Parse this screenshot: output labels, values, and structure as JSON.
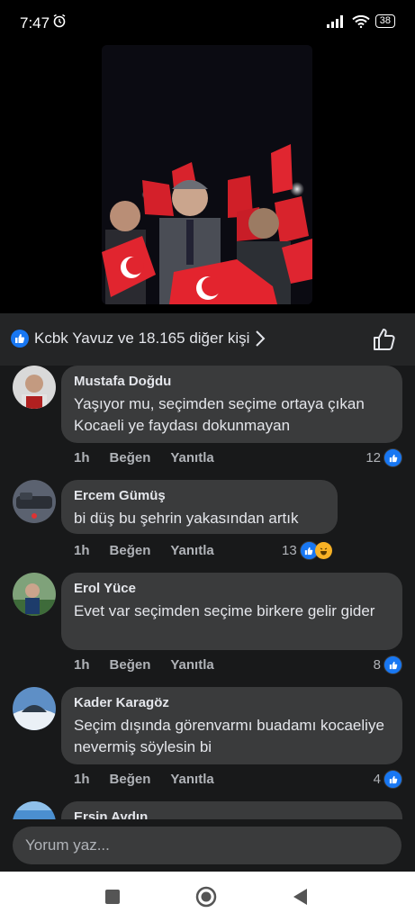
{
  "status": {
    "time": "7:47",
    "battery": "38"
  },
  "reactions": {
    "summary": "Kcbk Yavuz ve 18.165 diğer kişi"
  },
  "comments": [
    {
      "author": "Mustafa Doğdu",
      "text": "Yaşıyor mu, seçimden seçime ortaya çıkan Kocaeli ye faydası dokunmayan",
      "time": "1h",
      "like_label": "Beğen",
      "reply_label": "Yanıtla",
      "reaction_count": "12"
    },
    {
      "author": "Ercem Gümüş",
      "text": "bi düş bu şehrin yakasından artık",
      "time": "1h",
      "like_label": "Beğen",
      "reply_label": "Yanıtla",
      "reaction_count": "13"
    },
    {
      "author": "Erol Yüce",
      "text": "Evet var seçimden seçime birkere gelir gider",
      "time": "1h",
      "like_label": "Beğen",
      "reply_label": "Yanıtla",
      "reaction_count": "8"
    },
    {
      "author": "Kader Karagöz",
      "text": "Seçim dışında görenvarmı buadamı kocaeliye nevermiş söylesin bi",
      "time": "1h",
      "like_label": "Beğen",
      "reply_label": "Yanıtla",
      "reaction_count": "4"
    },
    {
      "author": "Ersin Aydın"
    }
  ],
  "input": {
    "placeholder": "Yorum yaz..."
  },
  "icons": {
    "like": "like-icon",
    "haha": "haha-icon",
    "chevron": "chevron-right-icon",
    "thumbs_up": "thumbs-up-icon",
    "recents": "square-icon",
    "home": "circle-icon",
    "back": "triangle-back-icon"
  },
  "colors": {
    "accent": "#1877f2",
    "bubble": "#3a3b3c",
    "background": "#18191a"
  }
}
